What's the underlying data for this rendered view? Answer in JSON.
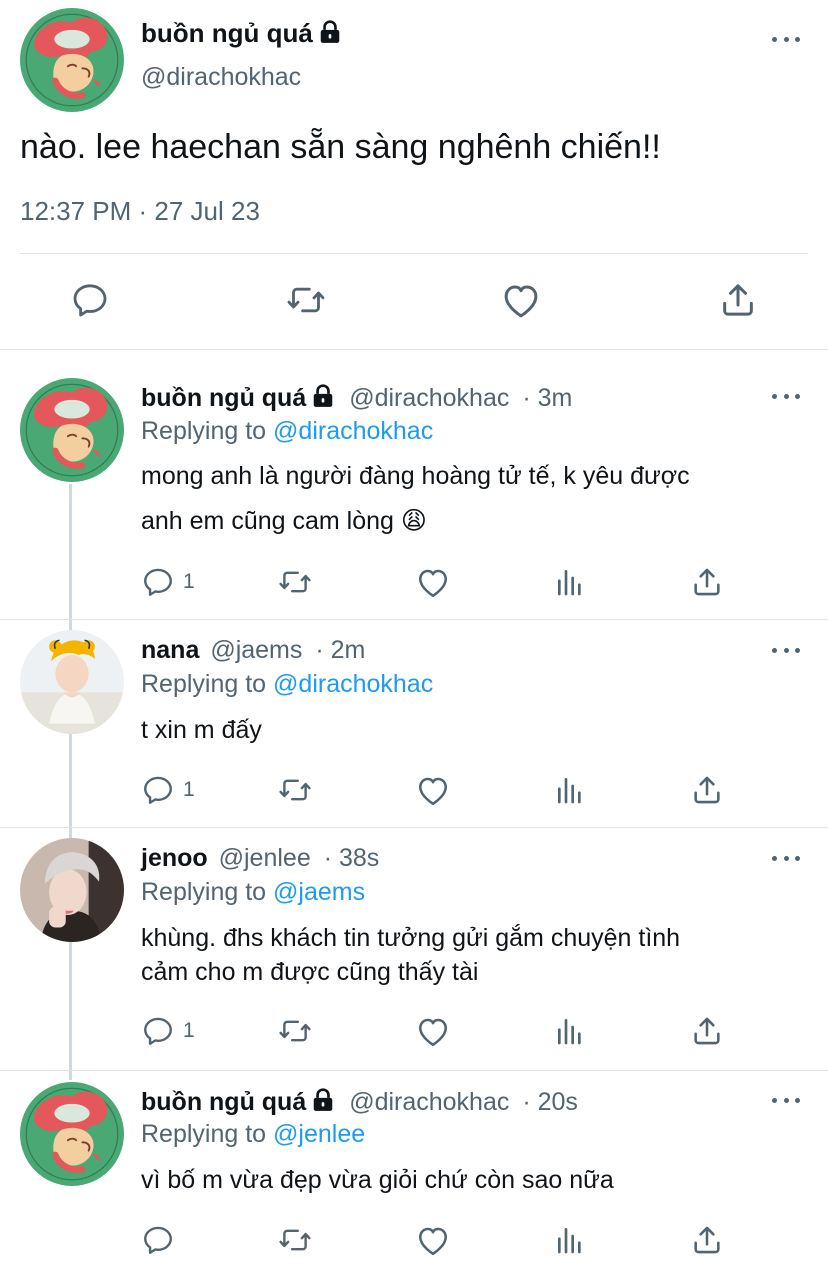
{
  "main_tweet": {
    "display_name": "buồn ngủ quá",
    "handle": "@dirachokhac",
    "text": "nào. lee haechan sẵn sàng nghênh chiến!!",
    "timestamp": "12:37 PM · 27 Jul 23",
    "avatar": "ponyo-avatar",
    "locked": true
  },
  "replies": [
    {
      "display_name": "buồn ngủ quá",
      "handle": "@dirachokhac",
      "time": "· 3m",
      "replying_label": "Replying to",
      "replying_to": "@dirachokhac",
      "text_lines": [
        "mong anh là người đàng hoàng tử tế, k yêu được",
        "anh em cũng cam lòng 😩"
      ],
      "reply_count": "1",
      "locked": true
    },
    {
      "display_name": "nana",
      "handle": "@jaems",
      "time": "· 2m",
      "replying_label": "Replying to",
      "replying_to": "@dirachokhac",
      "text_lines": [
        "t xin m đấy"
      ],
      "reply_count": "1",
      "locked": false
    },
    {
      "display_name": "jenoo",
      "handle": "@jenlee",
      "time": "· 38s",
      "replying_label": "Replying to",
      "replying_to": "@jaems",
      "text_lines": [
        "khùng. đhs khách tin tưởng gửi gắm chuyện tình",
        "cảm cho m được cũng thấy tài"
      ],
      "reply_count": "1",
      "locked": false
    },
    {
      "display_name": "buồn ngủ quá",
      "handle": "@dirachokhac",
      "time": "· 20s",
      "replying_label": "Replying to",
      "replying_to": "@jenlee",
      "text_lines": [
        "vì bố m vừa đẹp vừa giỏi chứ còn sao nữa"
      ],
      "reply_count": "",
      "locked": true
    }
  ],
  "icons": {
    "reply": "reply-icon",
    "retweet": "retweet-icon",
    "like": "like-icon",
    "analytics": "analytics-icon",
    "share": "share-icon",
    "more": "more-options-icon",
    "lock": "lock-icon"
  },
  "colors": {
    "text": "#0f1419",
    "muted": "#536471",
    "link": "#1d9bf0",
    "divider": "#e1e5e8",
    "thread_line": "#cfd9de",
    "avatar_bg": "#4aa874"
  }
}
